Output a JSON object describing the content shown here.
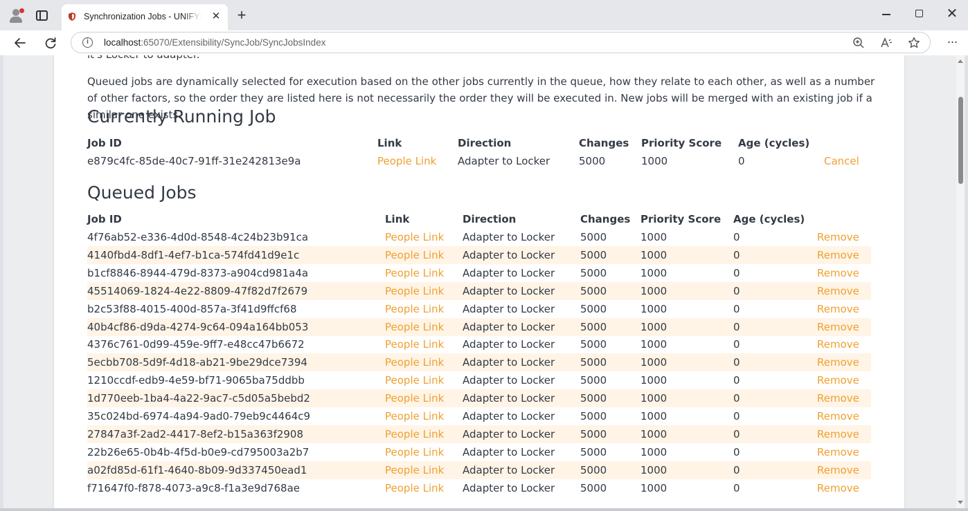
{
  "browser": {
    "tab_title": "Synchronization Jobs - UNIFYConnect",
    "close_tab_glyph": "✕",
    "new_tab_glyph": "+",
    "url_host": "localhost",
    "url_path": ":65070/Extensibility/SyncJob/SyncJobsIndex",
    "icons": [
      "profile-icon",
      "tab-actions-icon",
      "back-icon",
      "refresh-icon",
      "info-icon",
      "zoom-icon",
      "read-aloud-icon",
      "favorite-icon",
      "more-icon",
      "minimize-icon",
      "maximize-icon",
      "close-icon"
    ]
  },
  "page": {
    "cut_text": "it's Locker to adapter.",
    "intro": "Queued jobs are dynamically selected for execution based on the other jobs currently in the queue, how they relate to each other, as well as a number of other factors, so the order they are listed here is not necessarily the order they will be executed in. New jobs will be merged with an existing job if a similar one exists.",
    "running": {
      "title": "Currently Running Job",
      "headers": {
        "job_id": "Job ID",
        "link": "Link",
        "direction": "Direction",
        "changes": "Changes",
        "priority": "Priority Score",
        "age": "Age (cycles)"
      },
      "row": {
        "job_id": "e879c4fc-85de-40c7-91ff-31e242813e9a",
        "link": "People Link",
        "direction": "Adapter to Locker",
        "changes": "5000",
        "priority": "1000",
        "age": "0",
        "action": "Cancel"
      }
    },
    "queued": {
      "title": "Queued Jobs",
      "headers": {
        "job_id": "Job ID",
        "link": "Link",
        "direction": "Direction",
        "changes": "Changes",
        "priority": "Priority Score",
        "age": "Age (cycles)"
      },
      "rows": [
        {
          "job_id": "4f76ab52-e336-4d0d-8548-4c24b23b91ca",
          "link": "People Link",
          "direction": "Adapter to Locker",
          "changes": "5000",
          "priority": "1000",
          "age": "0",
          "action": "Remove"
        },
        {
          "job_id": "4140fbd4-8df1-4ef7-b1ca-574fd41d9e1c",
          "link": "People Link",
          "direction": "Adapter to Locker",
          "changes": "5000",
          "priority": "1000",
          "age": "0",
          "action": "Remove"
        },
        {
          "job_id": "b1cf8846-8944-479d-8373-a904cd981a4a",
          "link": "People Link",
          "direction": "Adapter to Locker",
          "changes": "5000",
          "priority": "1000",
          "age": "0",
          "action": "Remove"
        },
        {
          "job_id": "45514069-1824-4e22-8809-47f82d7f2679",
          "link": "People Link",
          "direction": "Adapter to Locker",
          "changes": "5000",
          "priority": "1000",
          "age": "0",
          "action": "Remove"
        },
        {
          "job_id": "b2c53f88-4015-400d-857a-3f41d9ffcf68",
          "link": "People Link",
          "direction": "Adapter to Locker",
          "changes": "5000",
          "priority": "1000",
          "age": "0",
          "action": "Remove"
        },
        {
          "job_id": "40b4cf86-d9da-4274-9c64-094a164bb053",
          "link": "People Link",
          "direction": "Adapter to Locker",
          "changes": "5000",
          "priority": "1000",
          "age": "0",
          "action": "Remove"
        },
        {
          "job_id": "4376c761-0d99-459e-9ff7-e48cc47b6672",
          "link": "People Link",
          "direction": "Adapter to Locker",
          "changes": "5000",
          "priority": "1000",
          "age": "0",
          "action": "Remove"
        },
        {
          "job_id": "5ecbb708-5d9f-4d18-ab21-9be29dce7394",
          "link": "People Link",
          "direction": "Adapter to Locker",
          "changes": "5000",
          "priority": "1000",
          "age": "0",
          "action": "Remove"
        },
        {
          "job_id": "1210ccdf-edb9-4e59-bf71-9065ba75ddbb",
          "link": "People Link",
          "direction": "Adapter to Locker",
          "changes": "5000",
          "priority": "1000",
          "age": "0",
          "action": "Remove"
        },
        {
          "job_id": "1d770eeb-1ba4-4a22-9ac7-c5d05a5bebd2",
          "link": "People Link",
          "direction": "Adapter to Locker",
          "changes": "5000",
          "priority": "1000",
          "age": "0",
          "action": "Remove"
        },
        {
          "job_id": "35c024bd-6974-4a94-9ad0-79eb9c4464c9",
          "link": "People Link",
          "direction": "Adapter to Locker",
          "changes": "5000",
          "priority": "1000",
          "age": "0",
          "action": "Remove"
        },
        {
          "job_id": "27847a3f-2ad2-4417-8ef2-b15a363f2908",
          "link": "People Link",
          "direction": "Adapter to Locker",
          "changes": "5000",
          "priority": "1000",
          "age": "0",
          "action": "Remove"
        },
        {
          "job_id": "22b26e65-0b4b-4f5d-b0e9-cd795003a2b7",
          "link": "People Link",
          "direction": "Adapter to Locker",
          "changes": "5000",
          "priority": "1000",
          "age": "0",
          "action": "Remove"
        },
        {
          "job_id": "a02fd85d-61f1-4640-8b09-9d337450ead1",
          "link": "People Link",
          "direction": "Adapter to Locker",
          "changes": "5000",
          "priority": "1000",
          "age": "0",
          "action": "Remove"
        },
        {
          "job_id": "f71647f0-f878-4073-a9c8-f1a3e9d768ae",
          "link": "People Link",
          "direction": "Adapter to Locker",
          "changes": "5000",
          "priority": "1000",
          "age": "0",
          "action": "Remove"
        }
      ]
    }
  },
  "colors": {
    "link": "#f0a030",
    "row_alt": "#fff4e6",
    "text": "#333a44"
  }
}
